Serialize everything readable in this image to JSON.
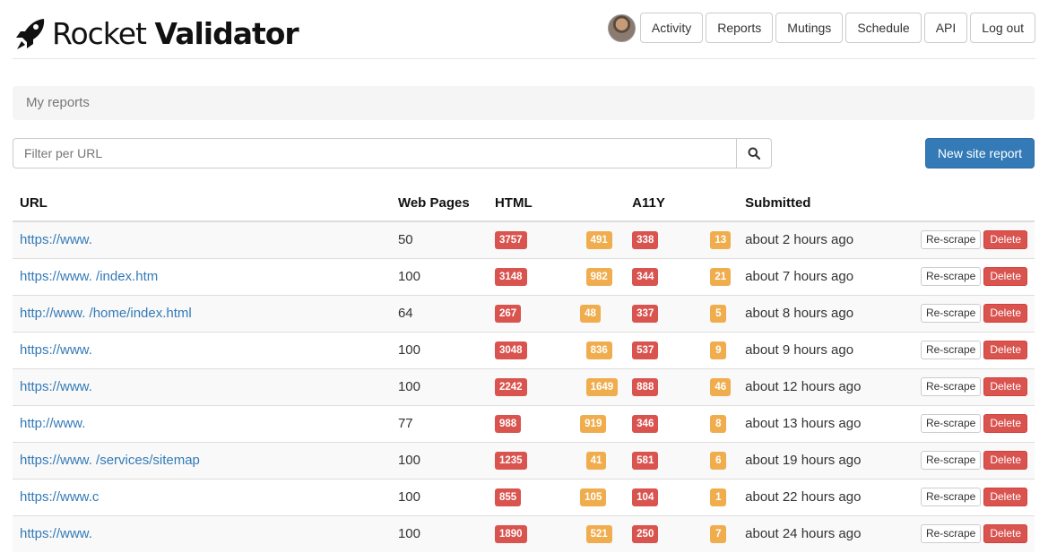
{
  "brand": {
    "name_regular": "Rocket",
    "name_bold": "Validator"
  },
  "nav": {
    "items": [
      "Activity",
      "Reports",
      "Mutings",
      "Schedule",
      "API",
      "Log out"
    ]
  },
  "breadcrumb": {
    "label": "My reports"
  },
  "filter": {
    "placeholder": "Filter per URL"
  },
  "new_report": {
    "label": "New site report"
  },
  "table": {
    "headers": {
      "url": "URL",
      "pages": "Web Pages",
      "html": "HTML",
      "a11y": "A11Y",
      "submitted": "Submitted"
    },
    "rows": [
      {
        "url": "https://www.",
        "pages": "50",
        "html_errors": "3757",
        "html_warnings": "491",
        "a11y_errors": "338",
        "a11y_warnings": "13",
        "submitted": "about 2 hours ago"
      },
      {
        "url": "https://www.  /index.htm",
        "pages": "100",
        "html_errors": "3148",
        "html_warnings": "982",
        "a11y_errors": "344",
        "a11y_warnings": "21",
        "submitted": "about 7 hours ago"
      },
      {
        "url": "http://www.  /home/index.html",
        "pages": "64",
        "html_errors": "267",
        "html_warnings": "48",
        "a11y_errors": "337",
        "a11y_warnings": "5",
        "submitted": "about 8 hours ago"
      },
      {
        "url": "https://www.",
        "pages": "100",
        "html_errors": "3048",
        "html_warnings": "836",
        "a11y_errors": "537",
        "a11y_warnings": "9",
        "submitted": "about 9 hours ago"
      },
      {
        "url": "https://www.",
        "pages": "100",
        "html_errors": "2242",
        "html_warnings": "1649",
        "a11y_errors": "888",
        "a11y_warnings": "46",
        "submitted": "about 12 hours ago"
      },
      {
        "url": "http://www.",
        "pages": "77",
        "html_errors": "988",
        "html_warnings": "919",
        "a11y_errors": "346",
        "a11y_warnings": "8",
        "submitted": "about 13 hours ago"
      },
      {
        "url": "https://www.  /services/sitemap",
        "pages": "100",
        "html_errors": "1235",
        "html_warnings": "41",
        "a11y_errors": "581",
        "a11y_warnings": "6",
        "submitted": "about 19 hours ago"
      },
      {
        "url": "https://www.c",
        "pages": "100",
        "html_errors": "855",
        "html_warnings": "105",
        "a11y_errors": "104",
        "a11y_warnings": "1",
        "submitted": "about 22 hours ago"
      },
      {
        "url": "https://www.",
        "pages": "100",
        "html_errors": "1890",
        "html_warnings": "521",
        "a11y_errors": "250",
        "a11y_warnings": "7",
        "submitted": "about 24 hours ago"
      }
    ],
    "actions": {
      "rescrape": "Re-scrape",
      "delete": "Delete"
    }
  },
  "colors": {
    "primary": "#337ab7",
    "danger": "#d9534f",
    "warning": "#f0ad4e"
  }
}
